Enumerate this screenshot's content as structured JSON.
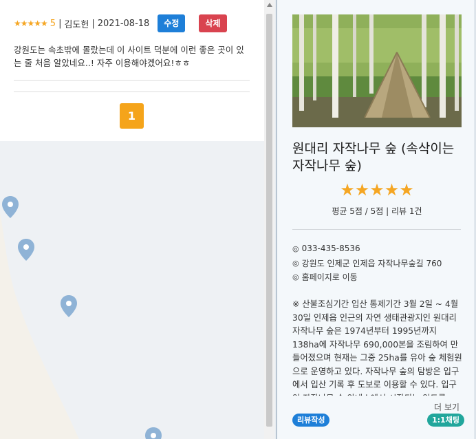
{
  "review": {
    "stars": "★★★★★",
    "score": "5",
    "author": "김도헌",
    "date": "2021-08-18",
    "edit_label": "수정",
    "delete_label": "삭제",
    "text": "강원도는 속초밖에 몰랐는데 이 사이트 덕분에 이런 좋은 곳이 있는 줄 처음 알았네요..! 자주 이용해야겠어요!ㅎㅎ"
  },
  "pagination": {
    "current_page": "1"
  },
  "place": {
    "title": "원대리 자작나무 숲 (속삭이는 자작나무 숲)",
    "stars": "★★★★★",
    "rating_summary": "평균 5점 / 5점 | 리뷰 1건",
    "phone": "033-435-8536",
    "address": "강원도 인제군 인제읍 자작나무숲길 760",
    "homepage_link": "홈페이지로 이동",
    "description": "※ 산불조심기간 입산 통제기간 3월 2일 ~ 4월 30일 인제읍 인근의 자연 생태관광지인 원대리 자작나무 숲은 1974년부터 1995년까지 138ha에 자작나무 690,000본을 조림하여 만들어졌으며 현재는 그중 25ha를 유아 숲 체험원으로 운영하고 있다. 자작나무 숲의 탐방은 입구에서 입산 기록 후 도보로 이용할 수 있다. 입구인 자작나무 숲 안내소에서 시작되는 임도를",
    "more_label": "더 보기",
    "write_review_label": "리뷰작성",
    "chat_label": "1:1채팅",
    "info_icon": "◎"
  },
  "colors": {
    "star": "#f5a623",
    "edit": "#1e7fd8",
    "delete": "#d9434f",
    "page": "#f5a41a",
    "chat": "#21a69c"
  }
}
